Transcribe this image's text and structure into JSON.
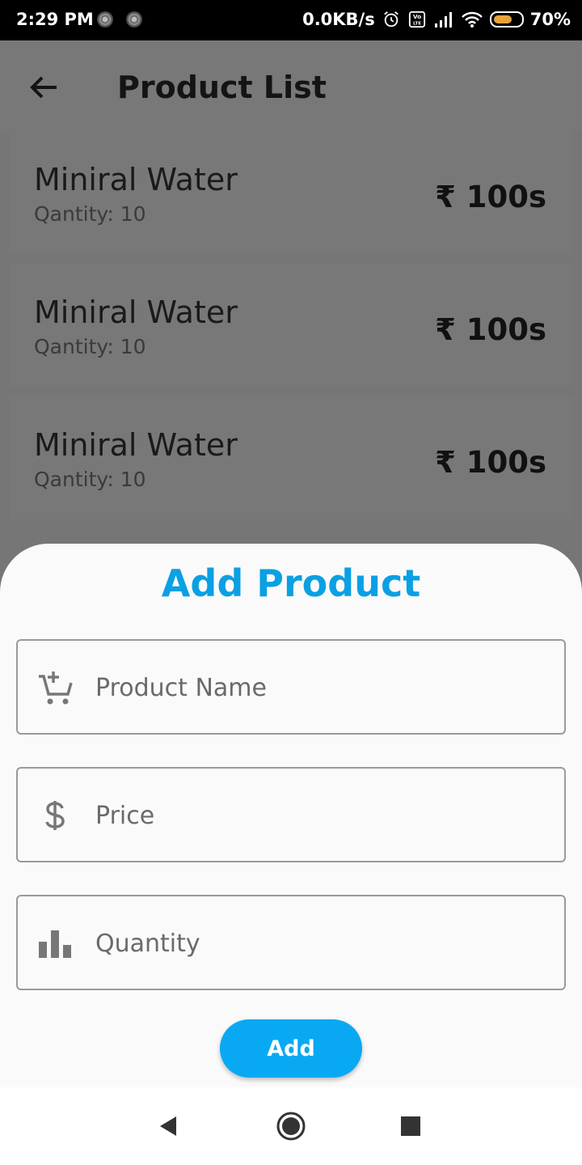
{
  "status_bar": {
    "time": "2:29 PM",
    "network_speed": "0.0KB/s",
    "battery_percent": "70%",
    "battery_level": 0.7,
    "icons": [
      "notification-dot-icon",
      "notification-dot-icon",
      "alarm-icon",
      "volte-icon",
      "signal-icon",
      "wifi-icon",
      "battery-icon"
    ]
  },
  "app_bar": {
    "title": "Product List",
    "back_icon": "arrow-left-icon"
  },
  "products": [
    {
      "name": "Miniral Water",
      "quantity": "Qantity: 10",
      "price": "₹ 100s"
    },
    {
      "name": "Miniral Water",
      "quantity": "Qantity: 10",
      "price": "₹ 100s"
    },
    {
      "name": "Miniral Water",
      "quantity": "Qantity: 10",
      "price": "₹ 100s"
    }
  ],
  "add_product_sheet": {
    "title": "Add Product",
    "fields": {
      "name": {
        "placeholder": "Product Name",
        "value": "",
        "icon": "add-shopping-cart-icon"
      },
      "price": {
        "placeholder": "Price",
        "value": "",
        "icon": "dollar-icon"
      },
      "quantity": {
        "placeholder": "Quantity",
        "value": "",
        "icon": "bar-chart-icon"
      }
    },
    "add_button_label": "Add"
  },
  "nav_bar": {
    "buttons": [
      "back-triangle-icon",
      "home-circle-icon",
      "recents-square-icon"
    ]
  },
  "colors": {
    "accent": "#0aa0e3",
    "button": "#08a9f2",
    "scrim": "#767676",
    "sheet_background": "#fafafa",
    "battery": "#e8a33a"
  }
}
